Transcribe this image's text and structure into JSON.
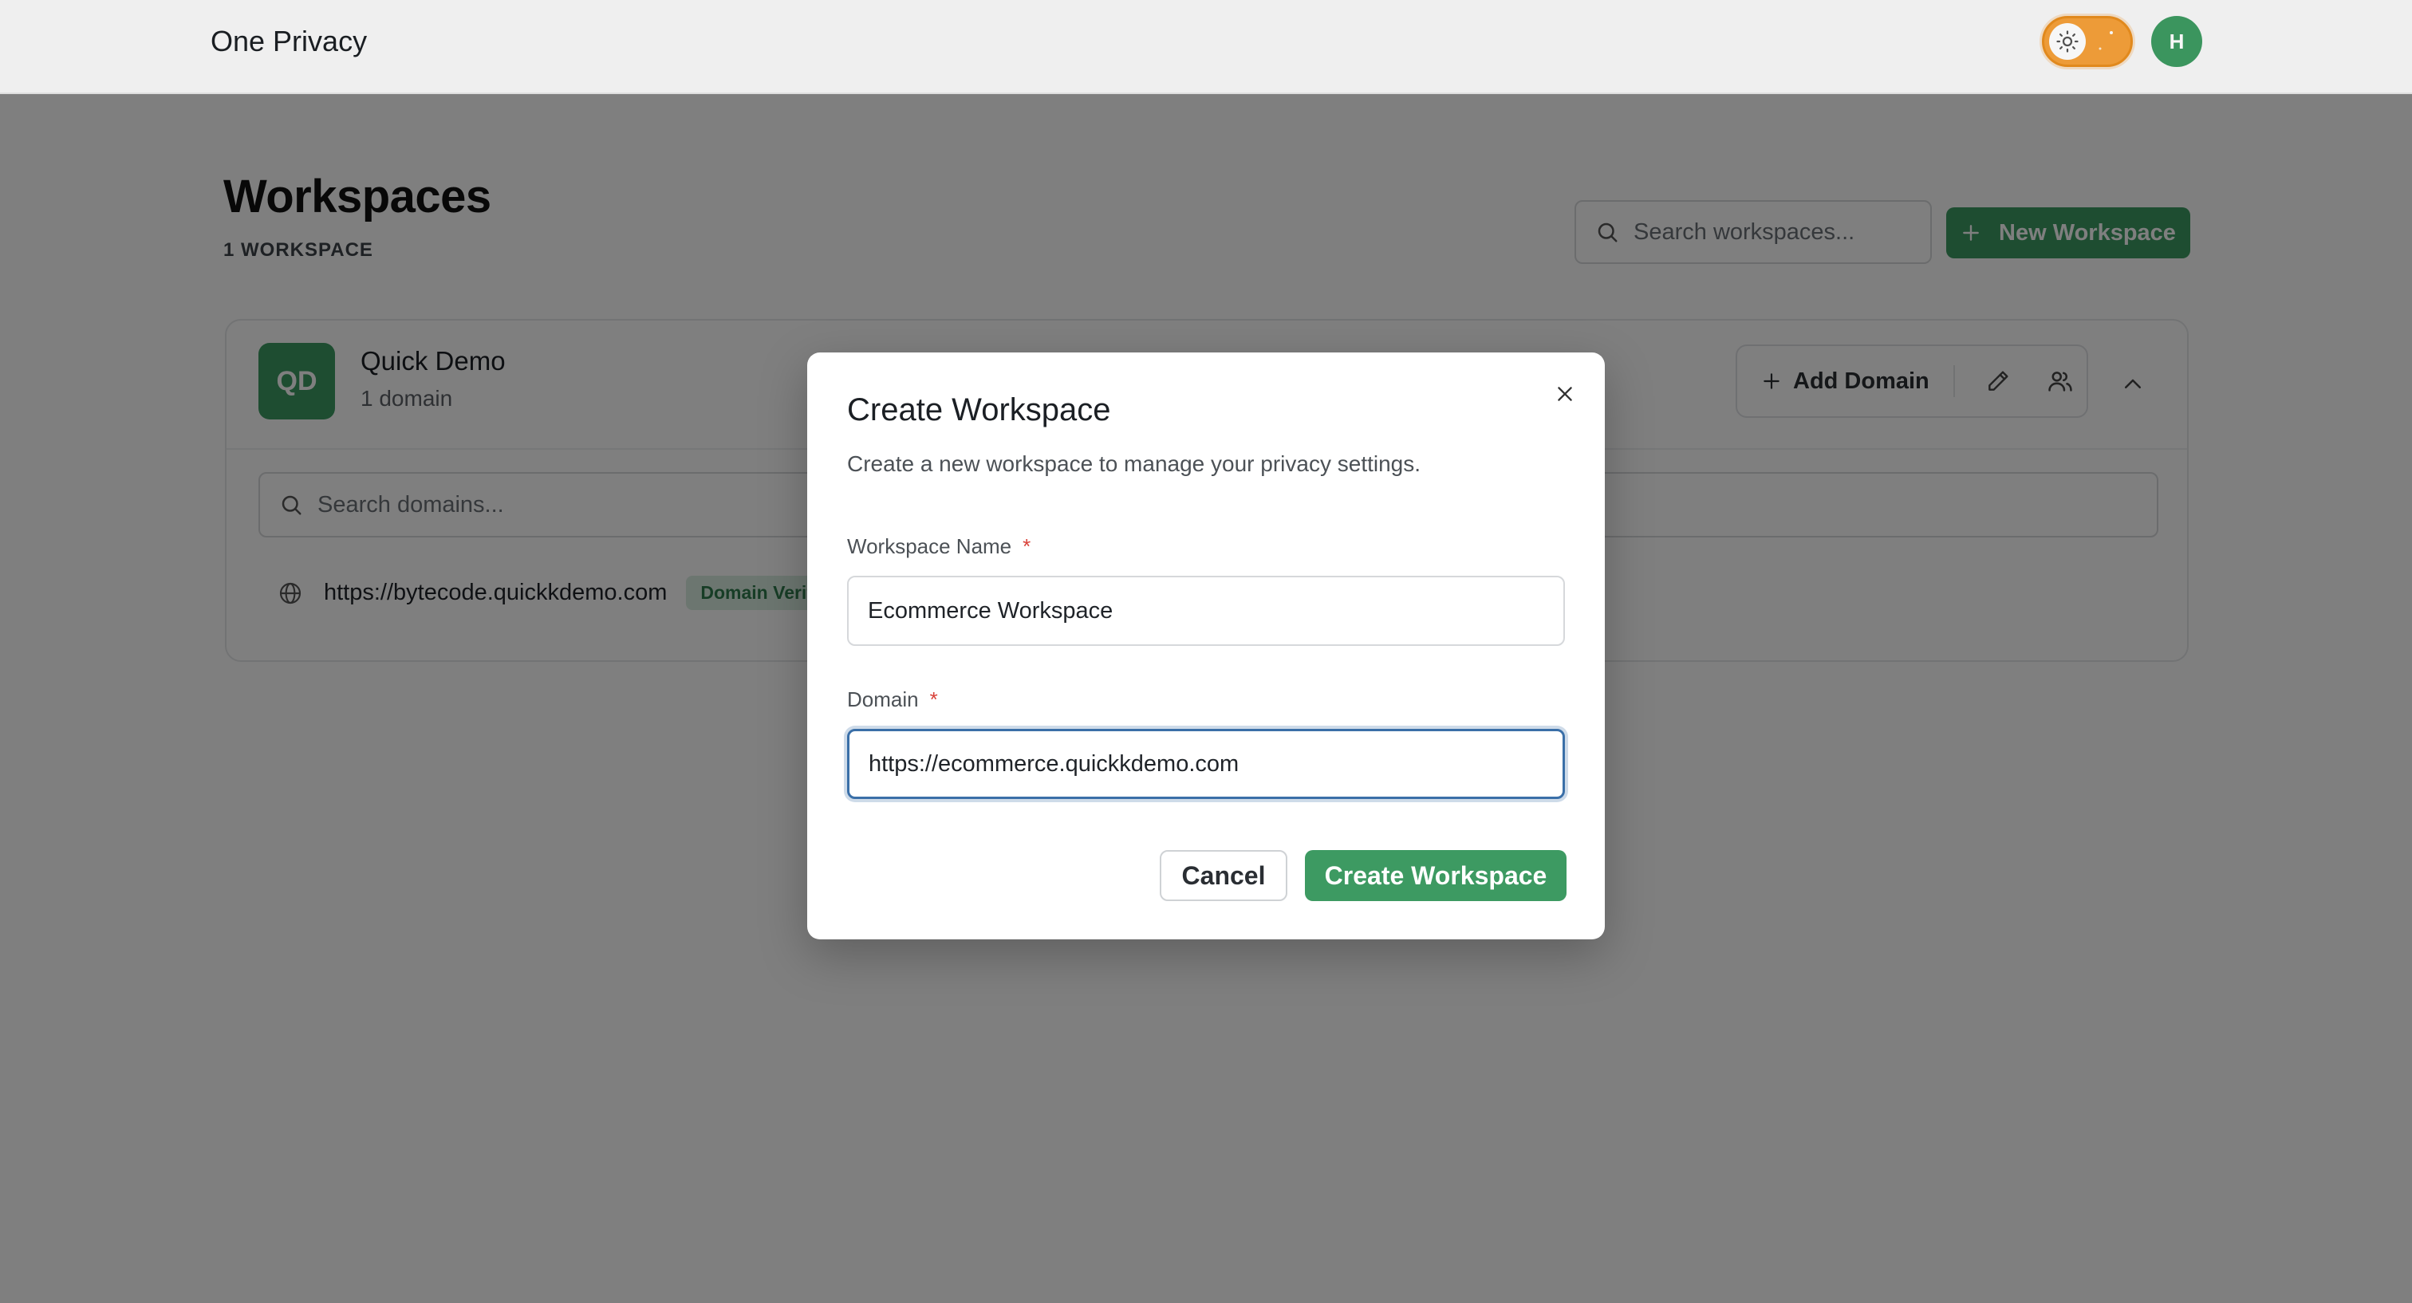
{
  "header": {
    "app_title": "One Privacy",
    "avatar_initial": "H",
    "theme_toggle": "light"
  },
  "page": {
    "title": "Workspaces",
    "count_label": "1 WORKSPACE",
    "search_placeholder": "Search workspaces...",
    "new_workspace_label": "New Workspace"
  },
  "workspace_card": {
    "initials": "QD",
    "name": "Quick Demo",
    "domain_count": "1 domain",
    "add_domain_label": "Add Domain",
    "domain_search_placeholder": "Search domains...",
    "domains": [
      {
        "url": "https://bytecode.quickkdemo.com",
        "status": "Domain Verified"
      }
    ]
  },
  "modal": {
    "title": "Create Workspace",
    "description": "Create a new workspace to manage your privacy settings.",
    "fields": {
      "workspace_name": {
        "label": "Workspace Name",
        "required_mark": "*",
        "value": "Ecommerce Workspace"
      },
      "domain": {
        "label": "Domain",
        "required_mark": "*",
        "value": "https://ecommerce.quickkdemo.com"
      }
    },
    "cancel_label": "Cancel",
    "create_label": "Create Workspace"
  },
  "colors": {
    "accent_green": "#3d9a62",
    "toggle_orange": "#f5a13a",
    "focus_blue": "#3a6fa8",
    "required_red": "#d9423a"
  }
}
